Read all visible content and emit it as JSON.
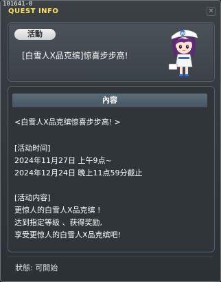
{
  "quest_id": "101641-0",
  "window_title": "QUEST INFO",
  "close_label": "×",
  "header": {
    "category_tag": "活動",
    "quest_name": "[白雪人X品克缤]惊喜步步高!"
  },
  "section_title": "內容",
  "description": [
    "<白雪人X品克缤惊喜步步高! >",
    "",
    "[活动时间]",
    "2024年11月27日 上午9点~",
    "2024年12月24日 晚上11点59分截止",
    "",
    "[活动内容]",
    "更惊人的白雪人X品克缤 !",
    "达到指定等级 、获得奖励,",
    "享受更惊人的白雪人X品克缤吧!"
  ],
  "status": "狀態: 可開始",
  "colors": {
    "title_yellow": "#ffe55a",
    "section_header": "#536570",
    "window_bg": "#30363a"
  }
}
